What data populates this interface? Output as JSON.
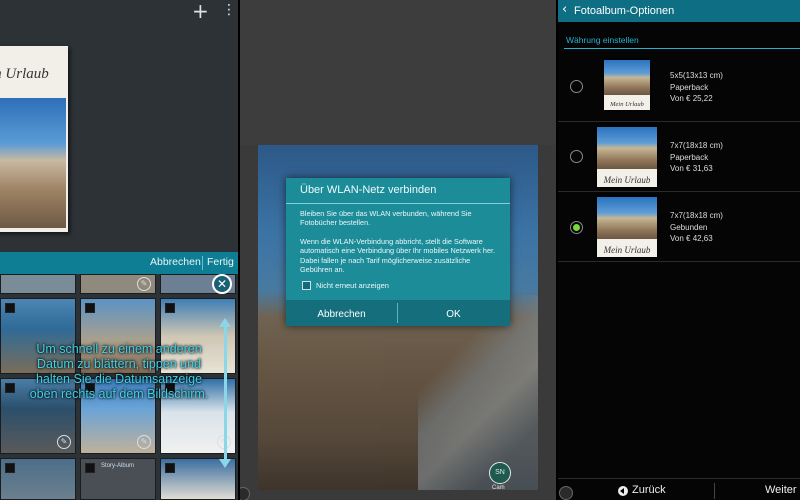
{
  "panel1": {
    "book_title": "in Urlaub",
    "actionbar": {
      "cancel_label": "Abbrechen",
      "done_label": "Fertig"
    },
    "tip_text": "Um schnell zu einem anderen Datum zu blättern, tippen und halten Sie die Datumsanzeige oben rechts auf dem Bildschirm.",
    "story_album_label": "Story-Album",
    "icons": [
      "plus-icon",
      "overflow-menu-icon",
      "close-icon",
      "edit-icon",
      "checkbox-icon"
    ]
  },
  "panel2": {
    "dialog": {
      "title": "Über WLAN-Netz verbinden",
      "paragraph1": "Bleiben Sie über das WLAN verbunden, während Sie Fotobücher bestellen.",
      "paragraph2": "Wenn die WLAN-Verbindung abbricht, stellt die Software automatisch eine Verbindung über Ihr mobiles Netzwerk her. Dabei fallen je nach Tarif möglicherweise zusätzliche Gebühren an.",
      "checkbox_label": "Nicht erneut anzeigen",
      "cancel_label": "Abbrechen",
      "ok_label": "OK"
    },
    "logo_text": "Cam"
  },
  "panel3": {
    "header_title": "Fotoalbum-Optionen",
    "section_label": "Währung einstellen",
    "options": [
      {
        "size": "5x5(13x13 cm)",
        "binding": "Paperback",
        "price": "Von € 25,22",
        "caption": "Mein Urlaub",
        "selected": false
      },
      {
        "size": "7x7(18x18 cm)",
        "binding": "Paperback",
        "price": "Von € 31,63",
        "caption": "Mein Urlaub",
        "selected": false
      },
      {
        "size": "7x7(18x18 cm)",
        "binding": "Gebunden",
        "price": "Von € 42,63",
        "caption": "Mein Urlaub",
        "selected": true
      }
    ],
    "back_label": "Zurück",
    "next_label": "Weiter"
  },
  "colors": {
    "accent_teal": "#0d7e93",
    "dialog_teal": "#1d8c99",
    "tip_cyan": "#3fd0e8",
    "radio_selected": "#79d936"
  }
}
